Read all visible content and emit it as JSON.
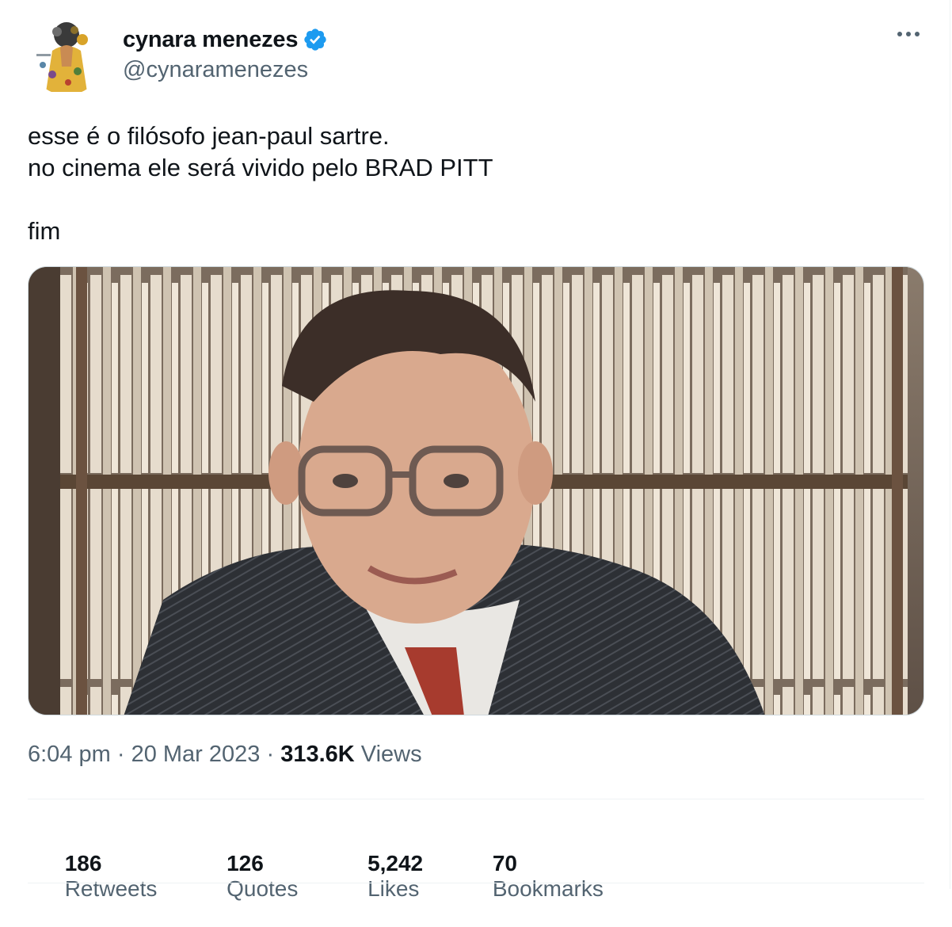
{
  "author": {
    "display_name": "cynara menezes",
    "handle": "@cynaramenezes",
    "verified": true,
    "verified_color": "#1d9bf0"
  },
  "tweet": {
    "text": "esse é o filósofo jean-paul sartre.\nno cinema ele será vivido pelo BRAD PITT\n\nfim",
    "time": "6:04 pm",
    "separator": " · ",
    "date": "20 Mar 2023",
    "views_count": "313.6K",
    "views_label": "Views"
  },
  "stats": [
    {
      "count": "186",
      "label": "Retweets"
    },
    {
      "count": "126",
      "label": "Quotes"
    },
    {
      "count": "5,242",
      "label": "Likes"
    },
    {
      "count": "70",
      "label": "Bookmarks"
    }
  ],
  "icons": {
    "verified": "verified-badge-icon",
    "more": "more-options-icon"
  }
}
